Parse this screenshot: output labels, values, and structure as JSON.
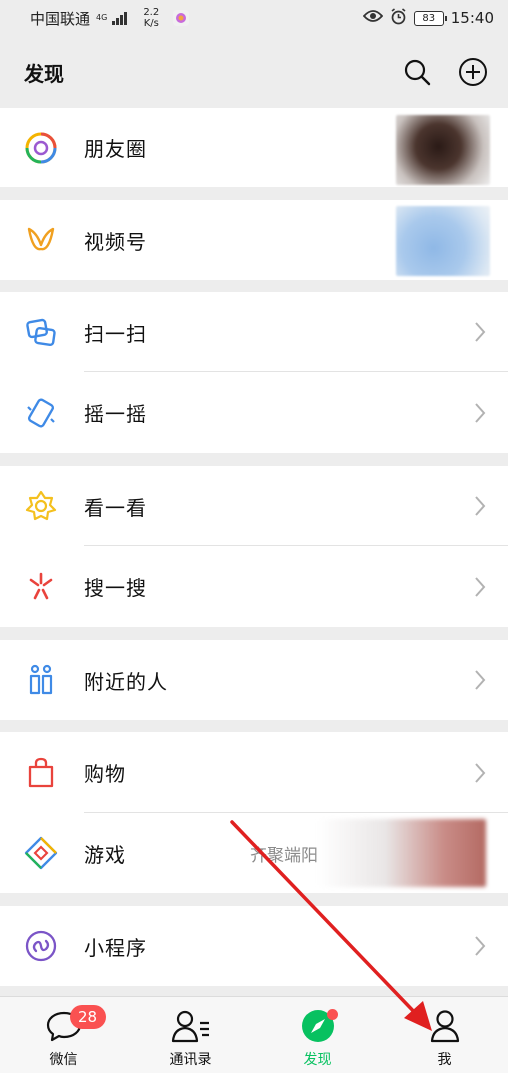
{
  "status_bar": {
    "carrier": "中国联通",
    "network_type": "4G",
    "speed_value": "2.2",
    "speed_unit": "K/s",
    "battery": "83",
    "time": "15:40"
  },
  "header": {
    "title": "发现",
    "search_icon": "search-icon",
    "add_icon": "plus-circle-icon"
  },
  "menu": {
    "moments": "朋友圈",
    "channels": "视频号",
    "scan": "扫一扫",
    "shake": "摇一摇",
    "top_stories": "看一看",
    "search": "搜一搜",
    "nearby": "附近的人",
    "shopping": "购物",
    "games": "游戏",
    "games_sub": "齐聚端阳",
    "mini_programs": "小程序"
  },
  "tabbar": {
    "chats": "微信",
    "chats_badge": "28",
    "contacts": "通讯录",
    "discover": "发现",
    "me": "我"
  },
  "colors": {
    "accent_green": "#07c160",
    "badge_red": "#fa5151",
    "annotation_arrow": "#e02020"
  }
}
